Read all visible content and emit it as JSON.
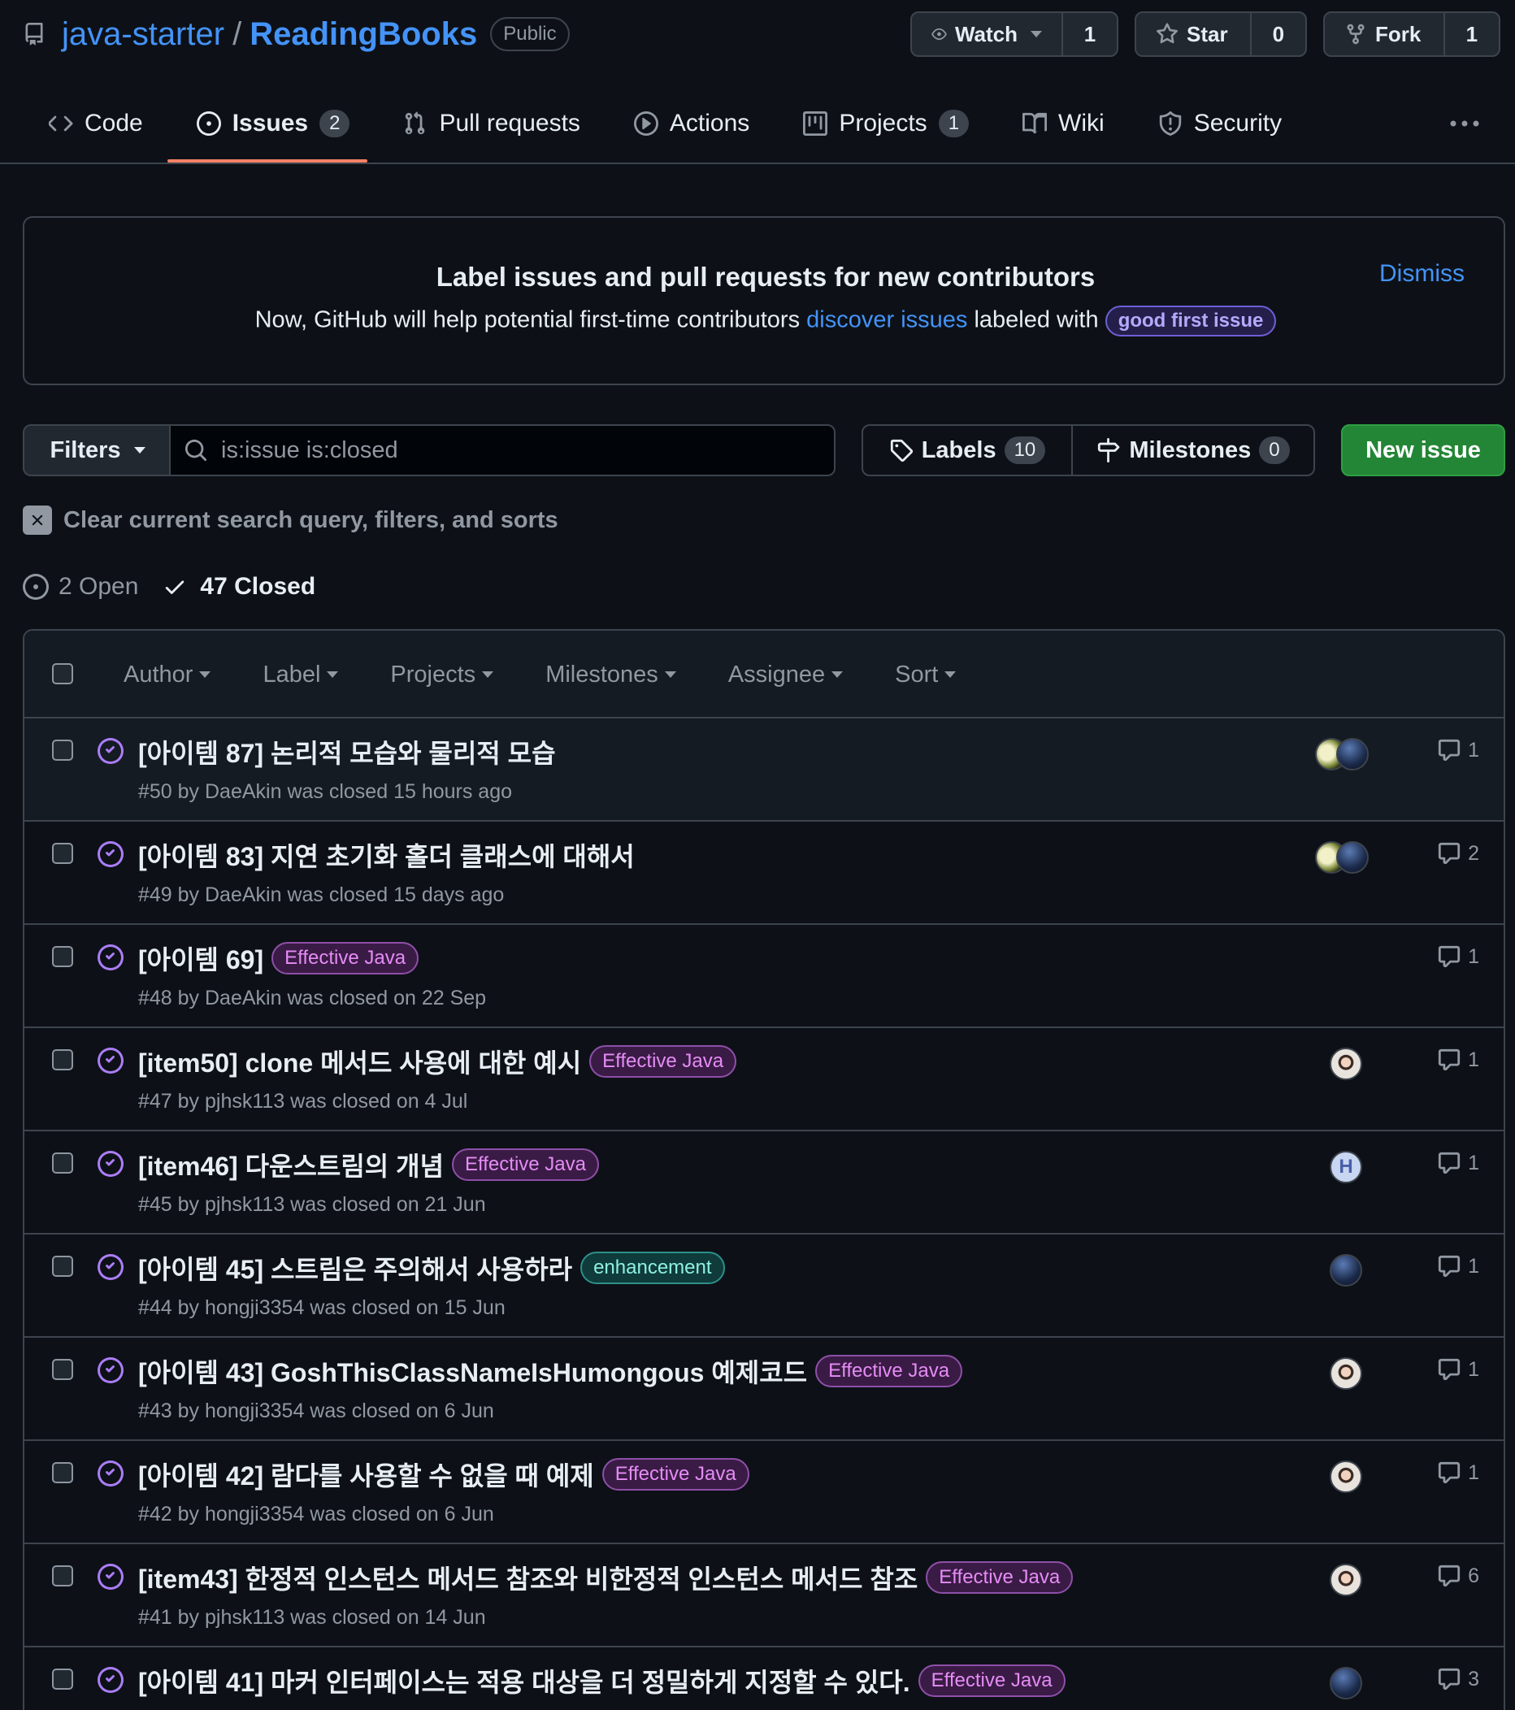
{
  "repo": {
    "owner": "java-starter",
    "separator": "/",
    "name": "ReadingBooks",
    "visibility": "Public"
  },
  "actions": {
    "watch": {
      "label": "Watch",
      "count": "1"
    },
    "star": {
      "label": "Star",
      "count": "0"
    },
    "fork": {
      "label": "Fork",
      "count": "1"
    }
  },
  "tabs": [
    {
      "label": "Code"
    },
    {
      "label": "Issues",
      "count": "2"
    },
    {
      "label": "Pull requests"
    },
    {
      "label": "Actions"
    },
    {
      "label": "Projects",
      "count": "1"
    },
    {
      "label": "Wiki"
    },
    {
      "label": "Security"
    }
  ],
  "banner": {
    "title": "Label issues and pull requests for new contributors",
    "text_before": "Now, GitHub will help potential first-time contributors ",
    "link": "discover issues",
    "text_after": " labeled with ",
    "label": "good first issue",
    "dismiss": "Dismiss"
  },
  "filterbar": {
    "filters_label": "Filters",
    "search_value": "is:issue is:closed",
    "labels_label": "Labels",
    "labels_count": "10",
    "milestones_label": "Milestones",
    "milestones_count": "0",
    "new_issue": "New issue"
  },
  "clear_text": "Clear current search query, filters, and sorts",
  "states": {
    "open": "2 Open",
    "closed": "47 Closed"
  },
  "list_filters": [
    "Author",
    "Label",
    "Projects",
    "Milestones",
    "Assignee",
    "Sort"
  ],
  "issues": [
    {
      "title": "[아이템 87] 논리적 모습와 물리적 모습",
      "label": "",
      "meta": "#50 by DaeAkin was closed 15 hours ago",
      "comments": "1"
    },
    {
      "title": "[아이템 83] 지연 초기화 홀더 클래스에 대해서",
      "label": "",
      "meta": "#49 by DaeAkin was closed 15 days ago",
      "comments": "2"
    },
    {
      "title": "[아이템 69]",
      "label": "Effective Java",
      "meta": "#48 by DaeAkin was closed on 22 Sep",
      "comments": "1"
    },
    {
      "title": "[item50] clone 메서드 사용에 대한 예시",
      "label": "Effective Java",
      "meta": "#47 by pjhsk113 was closed on 4 Jul",
      "comments": "1"
    },
    {
      "title": "[item46] 다운스트림의 개념",
      "label": "Effective Java",
      "meta": "#45 by pjhsk113 was closed on 21 Jun",
      "comments": "1"
    },
    {
      "title": "[아이템 45] 스트림은 주의해서 사용하라",
      "label": "enhancement",
      "meta": "#44 by hongji3354 was closed on 15 Jun",
      "comments": "1"
    },
    {
      "title": "[아이템 43] GoshThisClassNameIsHumongous 예제코드",
      "label": "Effective Java",
      "meta": "#43 by hongji3354 was closed on 6 Jun",
      "comments": "1"
    },
    {
      "title": "[아이템 42] 람다를 사용할 수 없을 때 예제",
      "label": "Effective Java",
      "meta": "#42 by hongji3354 was closed on 6 Jun",
      "comments": "1"
    },
    {
      "title": "[item43] 한정적 인스턴스 메서드 참조와 비한정적 인스턴스 메서드 참조",
      "label": "Effective Java",
      "meta": "#41 by pjhsk113 was closed on 14 Jun",
      "comments": "6"
    },
    {
      "title": "[아이템 41] 마커 인터페이스는 적용 대상을 더 정밀하게 지정할 수 있다.",
      "label": "Effective Java",
      "meta": "",
      "comments": "3"
    }
  ]
}
